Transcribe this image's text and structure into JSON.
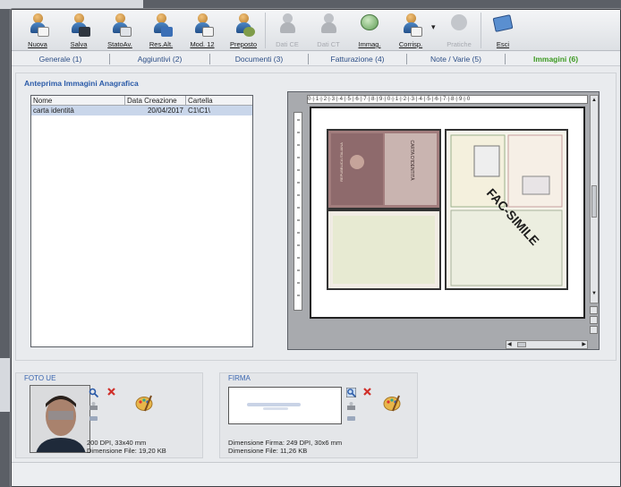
{
  "toolbar": {
    "buttons": [
      {
        "label": "Nuova",
        "enabled": true
      },
      {
        "label": "Salva",
        "enabled": true
      },
      {
        "label": "StatoAv.",
        "enabled": true
      },
      {
        "label": "Res.Alt.",
        "enabled": true
      },
      {
        "label": "Mod. 12",
        "enabled": true
      },
      {
        "label": "Preposto",
        "enabled": true
      },
      {
        "label": "Dati CE",
        "enabled": false
      },
      {
        "label": "Dati CT",
        "enabled": false
      },
      {
        "label": "Immag.",
        "enabled": true
      },
      {
        "label": "Corrisp.",
        "enabled": true
      },
      {
        "label": "Pratiche",
        "enabled": false
      },
      {
        "label": "Esci",
        "enabled": true
      }
    ]
  },
  "tabs": [
    {
      "label": "Generale (1)",
      "active": false
    },
    {
      "label": "Aggiuntivi (2)",
      "active": false
    },
    {
      "label": "Documenti (3)",
      "active": false
    },
    {
      "label": "Fatturazione (4)",
      "active": false
    },
    {
      "label": "Note / Varie (5)",
      "active": false
    },
    {
      "label": "Immagini (6)",
      "active": true
    }
  ],
  "preview": {
    "title": "Anteprima Immagini Anagrafica",
    "columns": [
      "Nome",
      "Data Creazione",
      "Cartella"
    ],
    "rows": [
      {
        "nome": "carta identità",
        "data": "20/04/2017",
        "cartella": "C1\\C1\\"
      }
    ],
    "ruler_text": "0·|·1·|·2·|·3·|·4·|·5·|·6·|·7·|·8·|·9·|·0·|·1·|·2·|·3·|·4·|·5·|·6·|·7·|·8·|·9·|·0",
    "watermark": "FAC-SIMILE",
    "doc_header": "CARTA D'IDENTITÀ",
    "doc_country": "REPUBBLICA ITALIANA"
  },
  "foto": {
    "title": "FOTO UE",
    "line1": "200 DPI, 33x40 mm",
    "line2": "Dimensione File: 19,20 KB"
  },
  "firma": {
    "title": "FIRMA",
    "line1": "Dimensione Firma: 249 DPI, 30x6 mm",
    "line2": "Dimensione File: 11,26 KB"
  },
  "colors": {
    "accent": "#2a5aa8",
    "active_tab": "#3d9a22",
    "selection": "#c9d6ea"
  }
}
